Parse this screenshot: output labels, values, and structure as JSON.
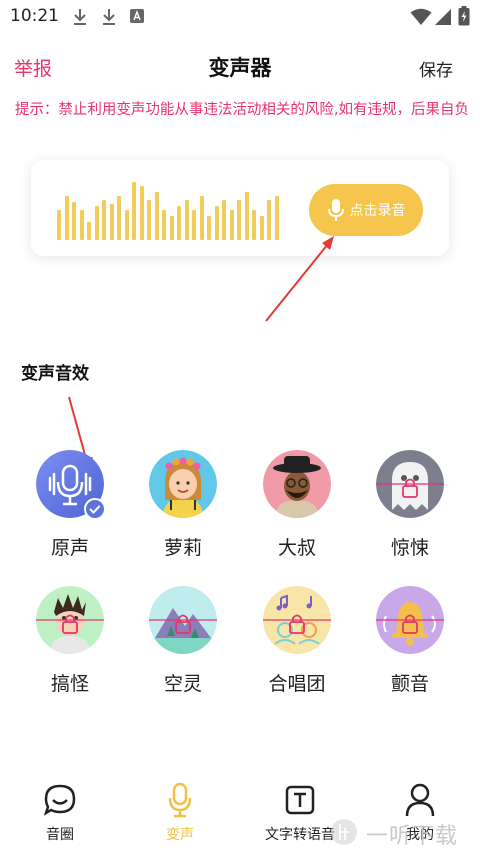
{
  "status_bar": {
    "time": "10:21"
  },
  "header": {
    "report": "举报",
    "title": "变声器",
    "save": "保存"
  },
  "notice": "提示：禁止利用变声功能从事违法活动相关的风险,如有违规，后果自负",
  "record": {
    "button_label": "点击录音"
  },
  "effects": {
    "section_title": "变声音效",
    "items": [
      {
        "label": "原声",
        "selected": true
      },
      {
        "label": "萝莉"
      },
      {
        "label": "大叔"
      },
      {
        "label": "惊悚"
      },
      {
        "label": "搞怪"
      },
      {
        "label": "空灵"
      },
      {
        "label": "合唱团"
      },
      {
        "label": "颤音"
      }
    ]
  },
  "nav": {
    "items": [
      {
        "label": "音圈"
      },
      {
        "label": "变声",
        "active": true
      },
      {
        "label": "文字转语音"
      },
      {
        "label": "我的"
      }
    ]
  },
  "watermark": "一听下载",
  "colors": {
    "accent_pink": "#e8336b",
    "accent_yellow": "#f6c54d",
    "selected_blue": "#5d74dd"
  }
}
